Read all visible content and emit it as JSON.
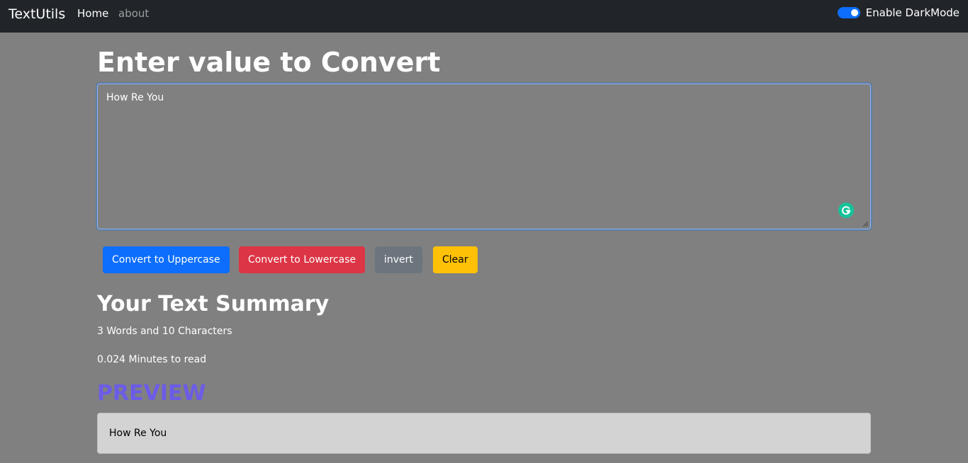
{
  "navbar": {
    "brand": "TextUtils",
    "links": [
      {
        "label": "Home"
      },
      {
        "label": "about"
      }
    ],
    "darkmode_label": "Enable DarkMode",
    "darkmode_on": true
  },
  "main": {
    "heading": "Enter value to Convert",
    "textarea_value": "How Re You"
  },
  "buttons": {
    "upper": "Convert to Uppercase",
    "lower": "Convert to Lowercase",
    "invert": "invert",
    "clear": "Clear"
  },
  "summary": {
    "title": "Your Text Summary",
    "words_chars": "3 Words and 10 Characters",
    "read_time": "0.024 Minutes to read"
  },
  "preview": {
    "title": "PREVIEW",
    "text": "How Re You"
  },
  "colors": {
    "navbar_bg": "#212529",
    "page_bg": "#808080",
    "primary": "#0d6efd",
    "danger": "#dc3545",
    "secondary": "#6c757d",
    "warning": "#ffc107",
    "preview_title": "#6c5ce7",
    "grammarly": "#15c39a"
  },
  "icons": {
    "grammarly": "grammarly-icon",
    "resize": "resize-handle-icon"
  }
}
